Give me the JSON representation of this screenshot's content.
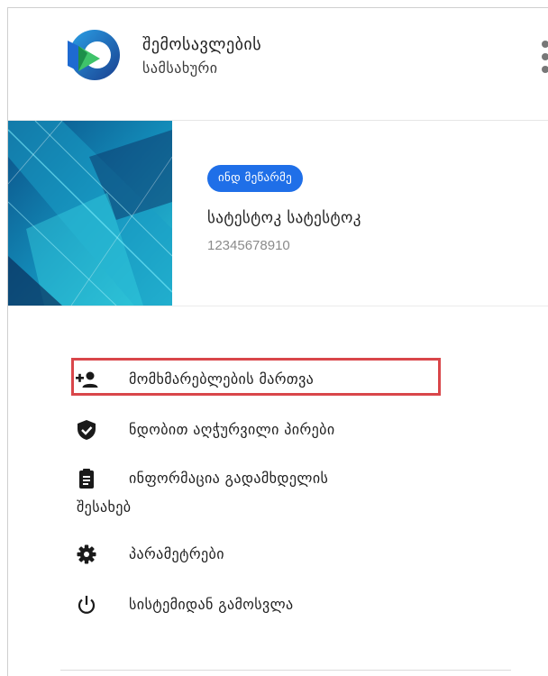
{
  "brand": {
    "line1": "შემოსავლების",
    "line2": "სამსახური",
    "logo_icon": "rs-logo-icon",
    "colors": {
      "blue_dark": "#1a3f8f",
      "blue_light": "#2aa0e6",
      "green": "#3fc36a"
    }
  },
  "header": {
    "menu_icon": "kebab-menu-icon"
  },
  "profile": {
    "role_badge": "ინდ მეწარმე",
    "name": "სატესტოკ სატესტოკ",
    "id_number": "12345678910",
    "badge_color": "#1f6fe8"
  },
  "menu": {
    "items": [
      {
        "label": "მომხმარებლების მართვა",
        "icon": "add-user-icon",
        "highlighted": true
      },
      {
        "label": "ნდობით აღჭურვილი პირები",
        "icon": "shield-check-icon"
      },
      {
        "label": "ინფორმაცია გადამხდელის",
        "label2": "შესახებ",
        "icon": "clipboard-icon"
      },
      {
        "label": "პარამეტრები",
        "icon": "gear-icon"
      },
      {
        "label": "სისტემიდან გამოსვლა",
        "icon": "power-icon"
      }
    ],
    "highlight_color": "#d9464a"
  }
}
